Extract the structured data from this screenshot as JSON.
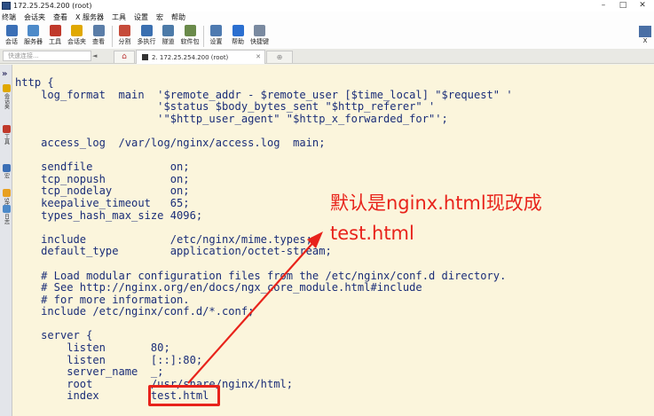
{
  "window": {
    "title": "172.25.254.200 (root)",
    "controls": [
      "–",
      "□",
      "✕"
    ]
  },
  "menu": [
    "终端",
    "会话夹",
    "查看",
    "X 服务器",
    "工具",
    "设置",
    "宏",
    "帮助"
  ],
  "toolbar": {
    "items": [
      {
        "label": "会话",
        "icon": "session-icon",
        "color": "#3b6fb6"
      },
      {
        "label": "服务器",
        "icon": "servers-icon",
        "color": "#4d8ac9"
      },
      {
        "label": "工具",
        "icon": "tools-icon",
        "color": "#c0392b"
      },
      {
        "label": "会话夹",
        "icon": "star-icon",
        "color": "#e0a800"
      },
      {
        "label": "查看",
        "icon": "view-icon",
        "color": "#5a7da8"
      },
      {
        "label": "分割",
        "icon": "split-icon",
        "color": "#c64b3a"
      },
      {
        "label": "多执行",
        "icon": "multiexec-icon",
        "color": "#3a6fb0"
      },
      {
        "label": "隧道",
        "icon": "tunnel-icon",
        "color": "#4c7aa8"
      },
      {
        "label": "软件包",
        "icon": "packages-icon",
        "color": "#6a8a4a"
      },
      {
        "label": "设置",
        "icon": "gear-icon",
        "color": "#4e7ab0"
      },
      {
        "label": "帮助",
        "icon": "help-icon",
        "color": "#2b6fd0"
      },
      {
        "label": "快捷键",
        "icon": "keyboard-icon",
        "color": "#7a8aa0"
      }
    ],
    "right": {
      "label": "X",
      "icon": "xserver-icon"
    }
  },
  "tabs": {
    "quick_connect_placeholder": "快速连接...",
    "home_icon": "home-icon",
    "active_tab": "2. 172.25.254.200 (root)",
    "close_glyph": "✕",
    "new_tab_glyph": "⊕"
  },
  "sidebar": {
    "chevron": "»",
    "items": [
      {
        "label": "会话夹",
        "icon": "star-icon",
        "color": "#e0a800"
      },
      {
        "label": "工具",
        "icon": "tools-icon",
        "color": "#c0392b"
      },
      {
        "label": "宏",
        "icon": "macro-icon",
        "color": "#3b6fb6"
      },
      {
        "label": "Sftp",
        "icon": "sftp-icon",
        "color": "#e8a020"
      },
      {
        "label": "日志",
        "icon": "log-icon",
        "color": "#4d8ac9"
      }
    ]
  },
  "terminal": {
    "lines": [
      "http {",
      "    log_format  main  '$remote_addr - $remote_user [$time_local] \"$request\" '",
      "                      '$status $body_bytes_sent \"$http_referer\" '",
      "                      '\"$http_user_agent\" \"$http_x_forwarded_for\"';",
      "",
      "    access_log  /var/log/nginx/access.log  main;",
      "",
      "    sendfile            on;",
      "    tcp_nopush          on;",
      "    tcp_nodelay         on;",
      "    keepalive_timeout   65;",
      "    types_hash_max_size 4096;",
      "",
      "    include             /etc/nginx/mime.types;",
      "    default_type        application/octet-stream;",
      "",
      "    # Load modular configuration files from the /etc/nginx/conf.d directory.",
      "    # See http://nginx.org/en/docs/ngx_core_module.html#include",
      "    # for more information.",
      "    include /etc/nginx/conf.d/*.conf;",
      "",
      "    server {",
      "        listen       80;",
      "        listen       [::]:80;",
      "        server_name  _;",
      "        root         /usr/share/nginx/html;",
      "        index        test.html"
    ]
  },
  "annotation": {
    "text": "默认是nginx.html现改成\ntest.html",
    "color": "#e8231b"
  }
}
